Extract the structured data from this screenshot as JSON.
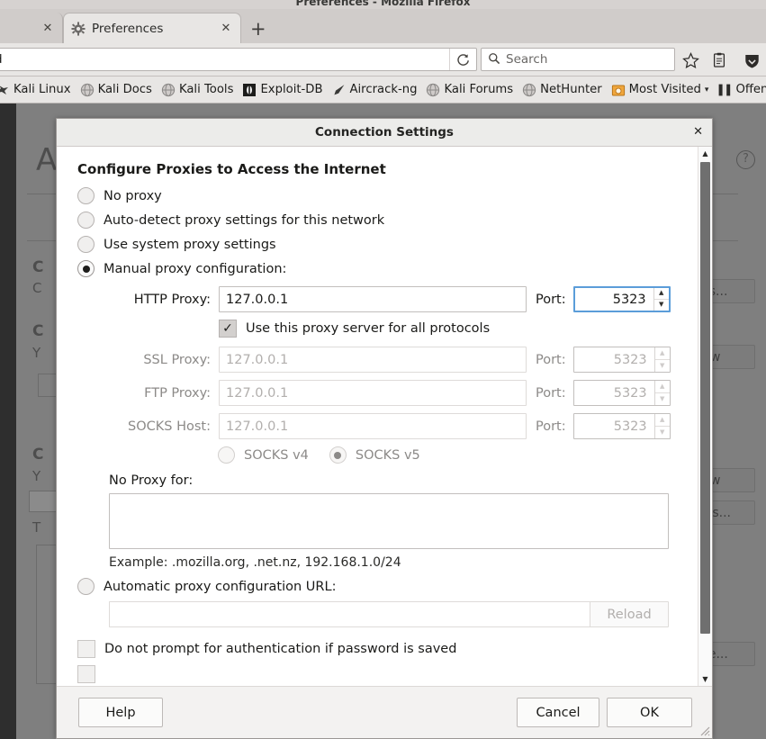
{
  "window": {
    "title": "Preferences - Mozilla Firefox"
  },
  "tabs": {
    "partial_tab_close": "✕",
    "active": {
      "title": "Preferences",
      "favicon": "gear-icon",
      "close": "✕"
    },
    "new_tab": "+"
  },
  "navbar": {
    "url": "eferences#advanced",
    "reload_icon": "reload-icon",
    "search_placeholder": "Search",
    "search_icon": "search-icon",
    "icons": [
      "star-icon",
      "library-icon",
      "shield-icon"
    ]
  },
  "bookmarks": [
    {
      "label": "Kali Linux",
      "icon": "dragon-icon"
    },
    {
      "label": "Kali Docs",
      "icon": "globe-icon"
    },
    {
      "label": "Kali Tools",
      "icon": "globe-icon"
    },
    {
      "label": "Exploit-DB",
      "icon": "exploitdb-icon"
    },
    {
      "label": "Aircrack-ng",
      "icon": "aircrack-icon"
    },
    {
      "label": "Kali Forums",
      "icon": "globe-icon"
    },
    {
      "label": "NetHunter",
      "icon": "globe-icon"
    },
    {
      "label": "Most Visited",
      "icon": "folder-icon",
      "caret": "▾"
    },
    {
      "label": "Offensive Se",
      "icon": "offsec-icon"
    }
  ],
  "background_page": {
    "heading": "A",
    "fragments": [
      "C",
      "C",
      "C",
      "Y",
      "C",
      "Y",
      "T"
    ],
    "buttons": [
      "ngs...",
      "Now",
      "Now",
      "ions...",
      "ove..."
    ],
    "help_icon": "question-circle-icon"
  },
  "dialog": {
    "title": "Connection Settings",
    "close": "✕",
    "section_heading": "Configure Proxies to Access the Internet",
    "proxy_modes": [
      {
        "label": "No proxy",
        "checked": false
      },
      {
        "label": "Auto-detect proxy settings for this network",
        "checked": false
      },
      {
        "label": "Use system proxy settings",
        "checked": false
      },
      {
        "label": "Manual proxy configuration:",
        "checked": true
      }
    ],
    "manual": {
      "fields": [
        {
          "label": "HTTP Proxy:",
          "value": "127.0.0.1",
          "port_label": "Port:",
          "port": "5323",
          "enabled": true,
          "focused": true
        },
        {
          "label": "SSL Proxy:",
          "value": "127.0.0.1",
          "port_label": "Port:",
          "port": "5323",
          "enabled": false,
          "focused": false
        },
        {
          "label": "FTP Proxy:",
          "value": "127.0.0.1",
          "port_label": "Port:",
          "port": "5323",
          "enabled": false,
          "focused": false
        },
        {
          "label": "SOCKS Host:",
          "value": "127.0.0.1",
          "port_label": "Port:",
          "port": "5323",
          "enabled": false,
          "focused": false
        }
      ],
      "use_for_all": {
        "label": "Use this proxy server for all protocols",
        "checked": true,
        "mark": "✓"
      },
      "socks_versions": [
        {
          "label": "SOCKS v4",
          "checked": false
        },
        {
          "label": "SOCKS v5",
          "checked": true
        }
      ]
    },
    "no_proxy_label": "No Proxy for:",
    "no_proxy_value": "",
    "example_text": "Example: .mozilla.org, .net.nz, 192.168.1.0/24",
    "pac": {
      "label": "Automatic proxy configuration URL:",
      "checked": false,
      "value": "",
      "reload_label": "Reload"
    },
    "no_prompt": {
      "label": "Do not prompt for authentication if password is saved",
      "checked": false
    },
    "scrollbar": {
      "up": "▲",
      "down": "▼"
    },
    "footer": {
      "help": "Help",
      "cancel": "Cancel",
      "ok": "OK"
    }
  },
  "colors": {
    "accent_focus": "#5b9dd9",
    "chrome_bg": "#e8e6e4",
    "tabbar_bg": "#d0ccca",
    "modal_overlay": "#7f7f7f",
    "dialog_header": "#ececea"
  }
}
